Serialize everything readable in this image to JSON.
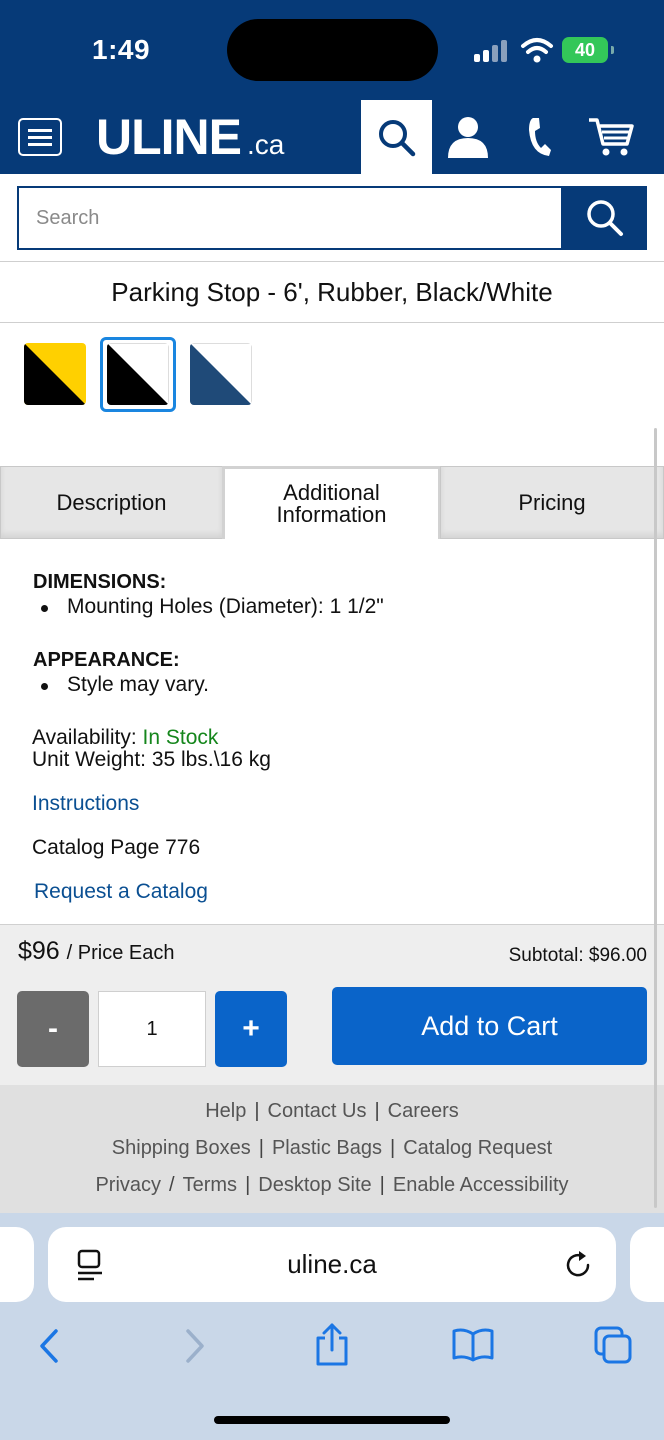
{
  "status_bar": {
    "time": "1:49",
    "battery": "40"
  },
  "header": {
    "logo_main": "ULINE",
    "logo_suffix": ".ca"
  },
  "search": {
    "placeholder": "Search"
  },
  "product": {
    "title": "Parking Stop - 6', Rubber, Black/White"
  },
  "swatches": [
    {
      "name": "black-yellow",
      "color_a": "#000000",
      "color_b": "#ffd000"
    },
    {
      "name": "black-white",
      "color_a": "#000000",
      "color_b": "#ffffff",
      "selected": true
    },
    {
      "name": "blue-white",
      "color_a": "#1f4a78",
      "color_b": "#ffffff"
    }
  ],
  "tabs": {
    "description": "Description",
    "additional_line1": "Additional",
    "additional_line2": "Information",
    "pricing": "Pricing"
  },
  "details": {
    "dimensions_heading": "DIMENSIONS:",
    "dimensions_item": "Mounting Holes (Diameter): 1 1/2\"",
    "appearance_heading": "APPEARANCE:",
    "appearance_item": "Style may vary.",
    "availability_label": "Availability:",
    "availability_value": "In Stock",
    "unit_weight": "Unit Weight: 35 lbs.\\16 kg",
    "instructions_link": "Instructions",
    "catalog_page": "Catalog Page 776",
    "request_catalog_link": "Request a Catalog"
  },
  "pricing": {
    "price": "$96",
    "price_suffix": "/ Price Each",
    "subtotal": "Subtotal: $96.00",
    "minus_label": "-",
    "quantity": "1",
    "plus_label": "+",
    "add_to_cart": "Add to Cart"
  },
  "footer": {
    "row1": [
      "Help",
      "Contact Us",
      "Careers"
    ],
    "row2": [
      "Shipping Boxes",
      "Plastic Bags",
      "Catalog Request"
    ],
    "row3": [
      "Privacy",
      "Terms",
      "Desktop Site",
      "Enable Accessibility"
    ]
  },
  "browser": {
    "url": "uline.ca"
  },
  "colors": {
    "brand_navy": "#063a78",
    "accent_blue": "#0a64c9",
    "in_stock_green": "#15861c",
    "link_blue": "#0a4f92"
  }
}
